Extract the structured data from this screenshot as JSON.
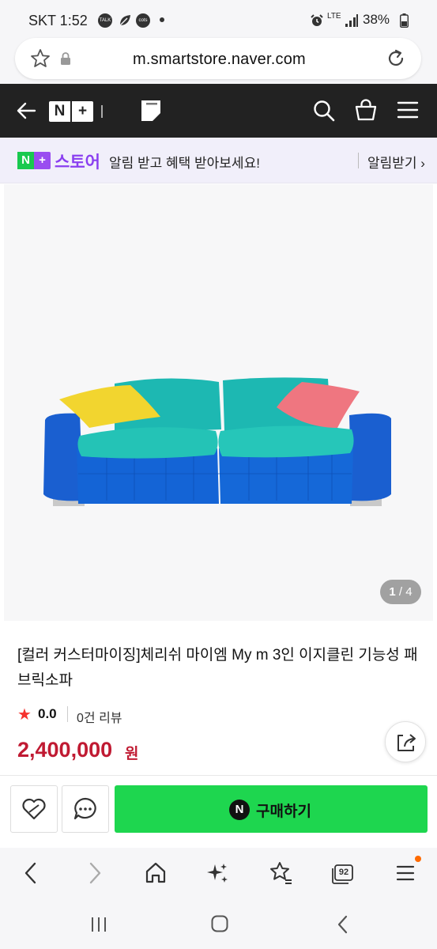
{
  "status_bar": {
    "time": "SKT 1:52",
    "icons": [
      "talk-icon",
      "leaf-icon",
      "coins-icon"
    ],
    "talk_label": "TALK",
    "coins_label": "cots",
    "network": "LTE",
    "battery": "38%"
  },
  "browser": {
    "url": "m.smartstore.naver.com",
    "tab_count": "92"
  },
  "header": {
    "logo_left": "N",
    "logo_right": "+"
  },
  "banner": {
    "logo_left": "N",
    "logo_right": "+",
    "store_name": "스토어",
    "message": "알림 받고 혜택 받아보세요!",
    "cta": "알림받기 ›"
  },
  "product": {
    "image_counter_current": "1",
    "image_counter_total": "/ 4",
    "title": "[컬러 커스터마이징]체리쉬 마이엠 My m 3인 이지클린 기능성 패브릭소파",
    "rating": "0.0",
    "reviews": "0건 리뷰",
    "price": "2,400,000",
    "price_unit": "원",
    "colors": {
      "price": "#c01a32",
      "star": "#f5322e"
    }
  },
  "actions": {
    "buy_label": "구매하기",
    "buy_badge": "N",
    "buy_color": "#1ed64f"
  }
}
